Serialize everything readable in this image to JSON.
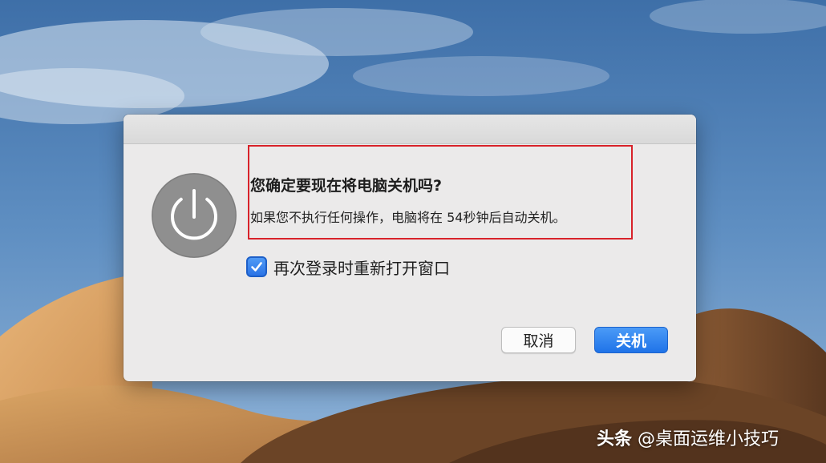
{
  "dialog": {
    "title": "您确定要现在将电脑关机吗?",
    "message": "如果您不执行任何操作，电脑将在 54秒钟后自动关机。",
    "reopen_windows": {
      "label": "再次登录时重新打开窗口",
      "checked": true
    },
    "buttons": {
      "cancel": "取消",
      "shutdown": "关机"
    },
    "icon": "power-icon",
    "highlight_color": "#d8222a"
  },
  "watermark": {
    "brand": "头条",
    "handle": "@桌面运维小技巧"
  },
  "colors": {
    "accent": "#2b74e6",
    "dialog_bg": "#ebeaea"
  }
}
